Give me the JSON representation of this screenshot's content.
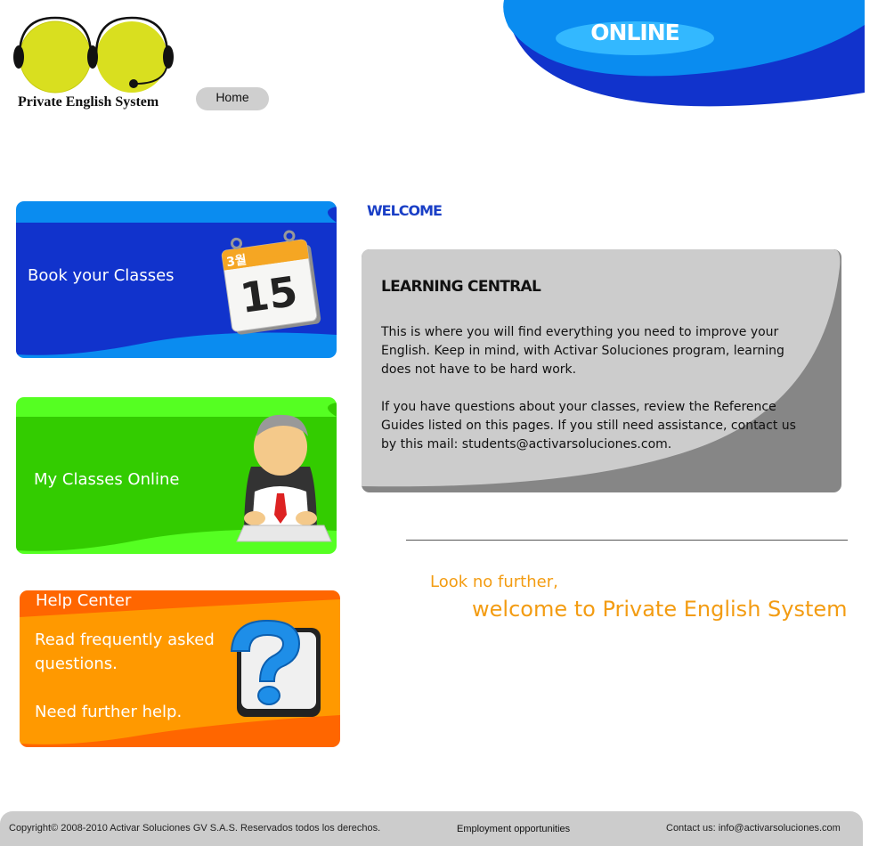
{
  "header": {
    "logo_text": "Private English System",
    "home_label": "Home",
    "badge": "ONLINE"
  },
  "cards": {
    "book": {
      "title": "Book your Classes",
      "calendar_month": "3월",
      "calendar_day": "15"
    },
    "online": {
      "title": "My Classes Online"
    },
    "help": {
      "title": "Help Center",
      "faq": "Read frequently asked questions.",
      "further": "Need further help."
    }
  },
  "main": {
    "welcome": "WELCOME",
    "panel": {
      "title": "LEARNING CENTRAL",
      "p1": "This is where you will find everything you need to improve your English. Keep in mind, with Activar Soluciones program, learning does not have to be hard work.",
      "p2": "If you have questions about your classes, review the Reference Guides listed on this pages. If you still need assistance, contact us by this mail: students@activarsoluciones.com."
    },
    "tagline_1": "Look no further,",
    "tagline_2": "welcome to Private English System"
  },
  "footer": {
    "copyright": "Copyright© 2008-2010 Activar Soluciones GV S.A.S. Reservados todos los derechos.",
    "employment": "Employment opportunities",
    "contact": "Contact us: info@activarsoluciones.com"
  },
  "colors": {
    "blue_dark": "#1133cc",
    "blue_light": "#0a8cf0",
    "green": "#33cc00",
    "green_light": "#55ff22",
    "orange": "#ff9900",
    "orange_dark": "#ff6600",
    "panel_gray": "#cccccc",
    "tagline": "#f39c12",
    "welcome": "#1a3fc6"
  }
}
